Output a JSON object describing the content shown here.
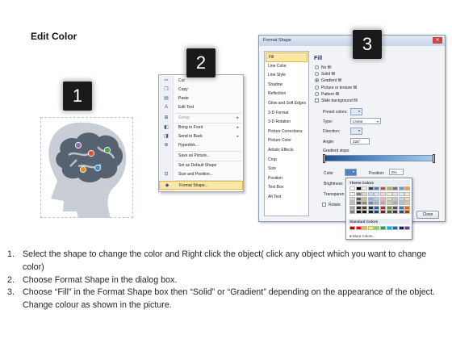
{
  "slide": {
    "title": "Edit Color"
  },
  "badges": [
    "1",
    "2",
    "3"
  ],
  "context_menu": {
    "items": [
      {
        "label": "Cut",
        "icon": "scissors-icon",
        "glyph": "✂",
        "disabled": false,
        "submenu": false
      },
      {
        "label": "Copy",
        "icon": "copy-icon",
        "glyph": "❐",
        "disabled": false,
        "submenu": false
      },
      {
        "label": "Paste",
        "icon": "paste-icon",
        "glyph": "▤",
        "disabled": false,
        "submenu": false
      },
      {
        "label": "Edit Text",
        "icon": "edit-text-icon",
        "glyph": "A",
        "disabled": false,
        "submenu": false
      },
      {
        "label": "Group",
        "icon": "group-icon",
        "glyph": "⊞",
        "disabled": true,
        "submenu": true
      },
      {
        "label": "Bring to Front",
        "icon": "bring-to-front-icon",
        "glyph": "◧",
        "disabled": false,
        "submenu": true
      },
      {
        "label": "Send to Back",
        "icon": "send-to-back-icon",
        "glyph": "◨",
        "disabled": false,
        "submenu": true
      },
      {
        "label": "Hyperlink...",
        "icon": "hyperlink-icon",
        "glyph": "⊕",
        "disabled": false,
        "submenu": false
      },
      {
        "label": "Save as Picture...",
        "icon": "",
        "glyph": "",
        "disabled": false,
        "submenu": false
      },
      {
        "label": "Set as Default Shape",
        "icon": "",
        "glyph": "",
        "disabled": false,
        "submenu": false
      },
      {
        "label": "Size and Position...",
        "icon": "size-position-icon",
        "glyph": "⊡",
        "disabled": false,
        "submenu": false
      },
      {
        "label": "Format Shape...",
        "icon": "format-shape-icon",
        "glyph": "◆",
        "disabled": false,
        "submenu": false,
        "active": true
      }
    ]
  },
  "dialog": {
    "title": "Format Shape",
    "close_glyph": "✕",
    "categories": [
      "Fill",
      "Line Color",
      "Line Style",
      "Shadow",
      "Reflection",
      "Glow and Soft Edges",
      "3-D Format",
      "3-D Rotation",
      "Picture Corrections",
      "Picture Color",
      "Artistic Effects",
      "Crop",
      "Size",
      "Position",
      "Text Box",
      "Alt Text"
    ],
    "active_category": "Fill",
    "fill_heading": "Fill",
    "fill_options": [
      {
        "label": "No fill",
        "type": "radio",
        "checked": false
      },
      {
        "label": "Solid fill",
        "type": "radio",
        "checked": false
      },
      {
        "label": "Gradient fill",
        "type": "radio",
        "checked": true
      },
      {
        "label": "Picture or texture fill",
        "type": "radio",
        "checked": false
      },
      {
        "label": "Pattern fill",
        "type": "radio",
        "checked": false
      },
      {
        "label": "Slide background fill",
        "type": "check",
        "checked": false
      }
    ],
    "preset_colors_label": "Preset colors:",
    "type_label": "Type:",
    "type_value": "Linear",
    "direction_label": "Direction:",
    "angle_label": "Angle:",
    "angle_value": "225°",
    "gradient_stops_label": "Gradient stops",
    "color_label": "Color",
    "position_label": "Position:",
    "position_value": "0%",
    "brightness_label": "Brightness",
    "transparency_label": "Transparen",
    "rotate_label": "Rotate",
    "close_label": "Close"
  },
  "palette": {
    "theme_heading": "Theme Colors",
    "standard_heading": "Standard Colors",
    "more_colors": "More Colors...",
    "theme_top": [
      "#ffffff",
      "#000000",
      "#eeece1",
      "#1f497d",
      "#4f81bd",
      "#c0504d",
      "#9bbb59",
      "#8064a2",
      "#4bacc6",
      "#f79646"
    ],
    "theme_shades": [
      [
        "#f2f2f2",
        "#7f7f7f",
        "#ddd9c3",
        "#c6d9f0",
        "#dbe5f1",
        "#f2dcdb",
        "#ebf1dd",
        "#e5e0ec",
        "#dbeef3",
        "#fdeada"
      ],
      [
        "#d8d8d8",
        "#595959",
        "#c4bd97",
        "#8db3e2",
        "#b8cce4",
        "#e5b9b7",
        "#d7e3bc",
        "#ccc1d9",
        "#b7dde8",
        "#fbd5b5"
      ],
      [
        "#bfbfbf",
        "#3f3f3f",
        "#938953",
        "#548dd4",
        "#95b3d7",
        "#d99694",
        "#c3d69b",
        "#b2a2c7",
        "#92cddc",
        "#fac08f"
      ],
      [
        "#a5a5a5",
        "#262626",
        "#494429",
        "#17365d",
        "#366092",
        "#953734",
        "#76923c",
        "#5f497a",
        "#31859b",
        "#e36c09"
      ],
      [
        "#7f7f7f",
        "#0c0c0c",
        "#1d1b10",
        "#0f243e",
        "#244061",
        "#632423",
        "#4f6128",
        "#3f3151",
        "#205867",
        "#974806"
      ]
    ],
    "standard": [
      "#c00000",
      "#ff0000",
      "#ffc000",
      "#ffff00",
      "#92d050",
      "#00b050",
      "#00b0f0",
      "#0070c0",
      "#002060",
      "#7030a0"
    ]
  },
  "head": {
    "silhouette_color": "#c9ced6",
    "brain_color": "#56626f",
    "node_colors": [
      "#b9c3cf",
      "#8a6fb8",
      "#e4493a",
      "#4aa63d",
      "#3d8fd6",
      "#f08b1e"
    ]
  },
  "instructions": [
    {
      "num": "1.",
      "text": "Select the shape to change the color and Right click the object( click any object which you want to change color)"
    },
    {
      "num": "2.",
      "text": "Choose Format Shape in the dialog box."
    },
    {
      "num": "3.",
      "text": "Choose “Fill” in the Format Shape box then “Solid” or “Gradient” depending on the appearance of the object. Change colour as shown in the picture."
    }
  ]
}
